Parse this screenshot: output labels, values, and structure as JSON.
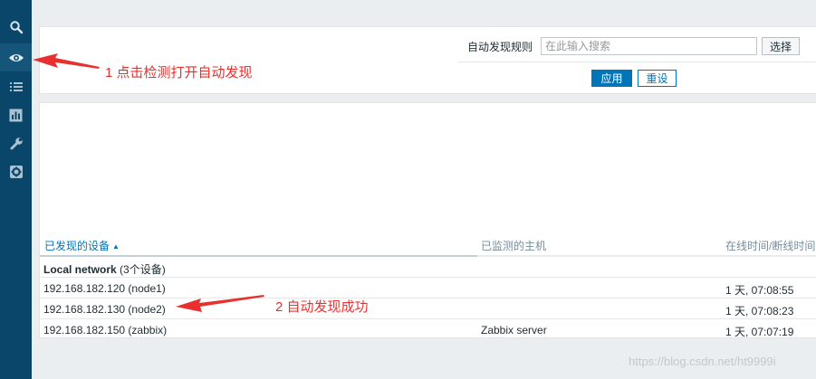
{
  "sidebar": {
    "items": [
      {
        "icon": "search-icon"
      },
      {
        "icon": "eye-icon",
        "active": true
      },
      {
        "icon": "list-icon"
      },
      {
        "icon": "chart-icon"
      },
      {
        "icon": "wrench-icon"
      },
      {
        "icon": "gear-icon"
      }
    ]
  },
  "filter": {
    "label": "自动发现规则",
    "placeholder": "在此输入搜索",
    "select_label": "选择",
    "apply_label": "应用",
    "reset_label": "重设"
  },
  "table": {
    "columns": [
      "已发现的设备",
      "已监测的主机",
      "在线时间/断线时间"
    ],
    "sort_indicator": "▲",
    "group": {
      "name": "Local network",
      "count": "(3个设备)"
    },
    "rows": [
      {
        "device": "192.168.182.120 (node1)",
        "host": "",
        "uptime": "1 天, 07:08:55"
      },
      {
        "device": "192.168.182.130 (node2)",
        "host": "",
        "uptime": "1 天, 07:08:23"
      },
      {
        "device": "192.168.182.150 (zabbix)",
        "host": "Zabbix server",
        "uptime": "1 天, 07:07:19"
      }
    ]
  },
  "annotations": {
    "step1": "1 点击检测打开自动发现",
    "step2": "2 自动发现成功"
  },
  "watermark": "https://blog.csdn.net/ht9999i",
  "colors": {
    "sidebar": "#0a466a",
    "accent": "#0275b8",
    "annotation": "#e8312f"
  }
}
